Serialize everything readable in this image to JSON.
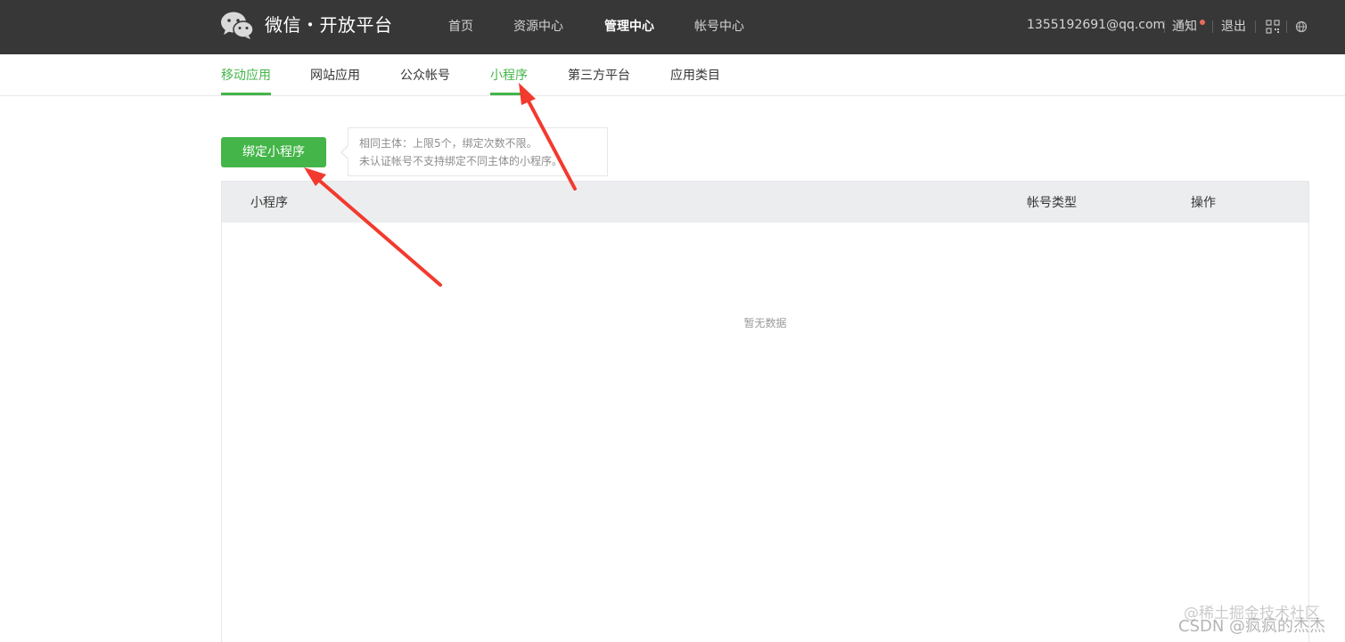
{
  "header": {
    "logo_text": "微信・开放平台",
    "nav": [
      {
        "label": "首页",
        "active": false
      },
      {
        "label": "资源中心",
        "active": false
      },
      {
        "label": "管理中心",
        "active": true
      },
      {
        "label": "帐号中心",
        "active": false
      }
    ],
    "account": "1355192691@qq.com",
    "notify_label": "通知",
    "logout_label": "退出",
    "icons": [
      "qrcode-icon",
      "globe-icon"
    ]
  },
  "subnav": {
    "items": [
      {
        "label": "移动应用",
        "active": true
      },
      {
        "label": "网站应用",
        "active": false
      },
      {
        "label": "公众帐号",
        "active": false
      },
      {
        "label": "小程序",
        "active": false
      },
      {
        "label": "第三方平台",
        "active": false
      },
      {
        "label": "应用类目",
        "active": false
      }
    ]
  },
  "main": {
    "bind_button": "绑定小程序",
    "tip_line1": "相同主体：上限5个，绑定次数不限。",
    "tip_line2": "未认证帐号不支持绑定不同主体的小程序。",
    "table": {
      "columns": [
        "小程序",
        "帐号类型",
        "操作"
      ],
      "empty_text": "暂无数据"
    }
  },
  "watermark": {
    "line1": "@稀土掘金技术社区",
    "line2": "CSDN @疯疯的杰杰"
  },
  "colors": {
    "header_bg": "#373737",
    "accent_green": "#44b549",
    "arrow_red": "#f23a2e"
  }
}
